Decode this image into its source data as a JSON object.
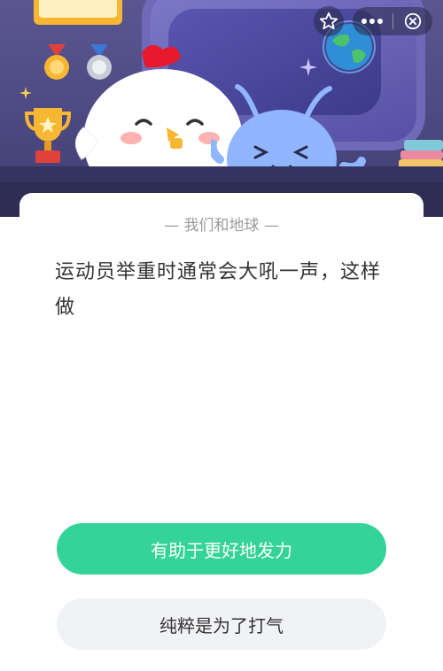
{
  "topbar": {
    "favorite_icon": "star-outline-icon",
    "more_icon": "more-dots-icon",
    "close_icon": "close-circle-icon"
  },
  "quiz": {
    "category": "— 我们和地球 —",
    "question": "运动员举重时通常会大吼一声，这样做",
    "answers": [
      {
        "label": "有助于更好地发力"
      },
      {
        "label": "纯粹是为了打气"
      }
    ]
  },
  "colors": {
    "primary_button": "#34d399",
    "secondary_button": "#f1f2f5",
    "hero_bg": "#4b4880"
  }
}
